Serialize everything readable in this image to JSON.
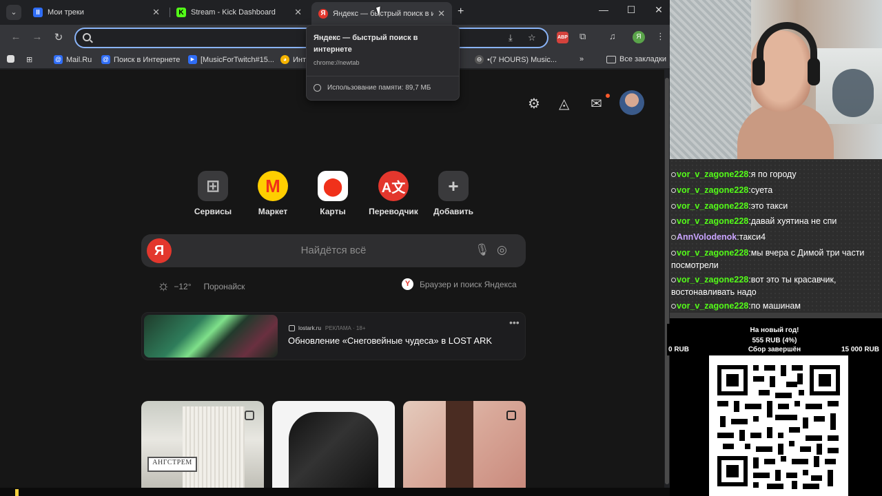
{
  "browser": {
    "tabs": [
      {
        "title": "Мои треки",
        "favicon": "II",
        "favicon_color": "#2f6df6"
      },
      {
        "title": "Stream - Kick Dashboard",
        "favicon": "K",
        "favicon_color": "#53fc18"
      },
      {
        "title": "Яндекс — быстрый поиск в интернете",
        "favicon": "Я",
        "favicon_color": "#e3372d",
        "active": true
      }
    ],
    "omnibox": {
      "value": "",
      "placeholder": ""
    },
    "bookmarks": [
      {
        "label": "Mail.Ru",
        "icon": "@"
      },
      {
        "label": "Поиск в Интернете",
        "icon": "@"
      },
      {
        "label": "[MusicForTwitch#15...",
        "icon": "▶"
      },
      {
        "label": "Инт",
        "icon": "◕"
      },
      {
        "label": "•(7 HOURS) Music...",
        "icon": "⊖"
      },
      {
        "label": "Все закладки",
        "icon": "folder"
      }
    ],
    "abp_label": "ABP",
    "profile_initial": "Я"
  },
  "tooltip": {
    "title": "Яндекс — быстрый поиск в интернете",
    "url": "chrome://newtab",
    "memory": "Использование памяти: 89,7 МБ"
  },
  "yandex": {
    "services": [
      {
        "label": "Сервисы",
        "icon": "grid-icon"
      },
      {
        "label": "Маркет",
        "icon": "market-icon"
      },
      {
        "label": "Карты",
        "icon": "maps-icon"
      },
      {
        "label": "Переводчик",
        "icon": "translate-icon"
      },
      {
        "label": "Добавить",
        "icon": "plus-icon"
      }
    ],
    "search_logo": "Я",
    "search_placeholder": "Найдётся всё",
    "weather": {
      "temp": "−12°",
      "forecast": "Поронайск"
    },
    "promo": "Браузер и поиск Яндекса",
    "ad": {
      "source": "lostark.ru",
      "tag": "РЕКЛАМА · 18+",
      "title": "Обновление «Снеговейные чудеса» в LOST ARK"
    },
    "card_brand": "АНГСТРЕМ"
  },
  "chat": [
    {
      "user": "vor_v_zagone228",
      "text": "я по городу"
    },
    {
      "user": "vor_v_zagone228",
      "text": "суета"
    },
    {
      "user": "vor_v_zagone228",
      "text": "это такси"
    },
    {
      "user": "vor_v_zagone228",
      "text": "давай хуятина не спи"
    },
    {
      "user": "AnnVolodenok",
      "text": "такси4"
    },
    {
      "user": "vor_v_zagone228",
      "text": "мы вчера с Димой три части посмотрели"
    },
    {
      "user": "vor_v_zagone228",
      "text": "вот это ты красавчик, востонавливать надо"
    },
    {
      "user": "vor_v_zagone228",
      "text": "по машинам"
    }
  ],
  "donation": {
    "goal_title": "На новый год!",
    "raised": "555 RUB (4%)",
    "min": "0 RUB",
    "status": "Сбор завершён",
    "max": "15 000 RUB",
    "progress": 0.04
  },
  "colors": {
    "accent": "#8ab4f8",
    "yandex_red": "#e3372d",
    "kick_green": "#53fc18"
  }
}
